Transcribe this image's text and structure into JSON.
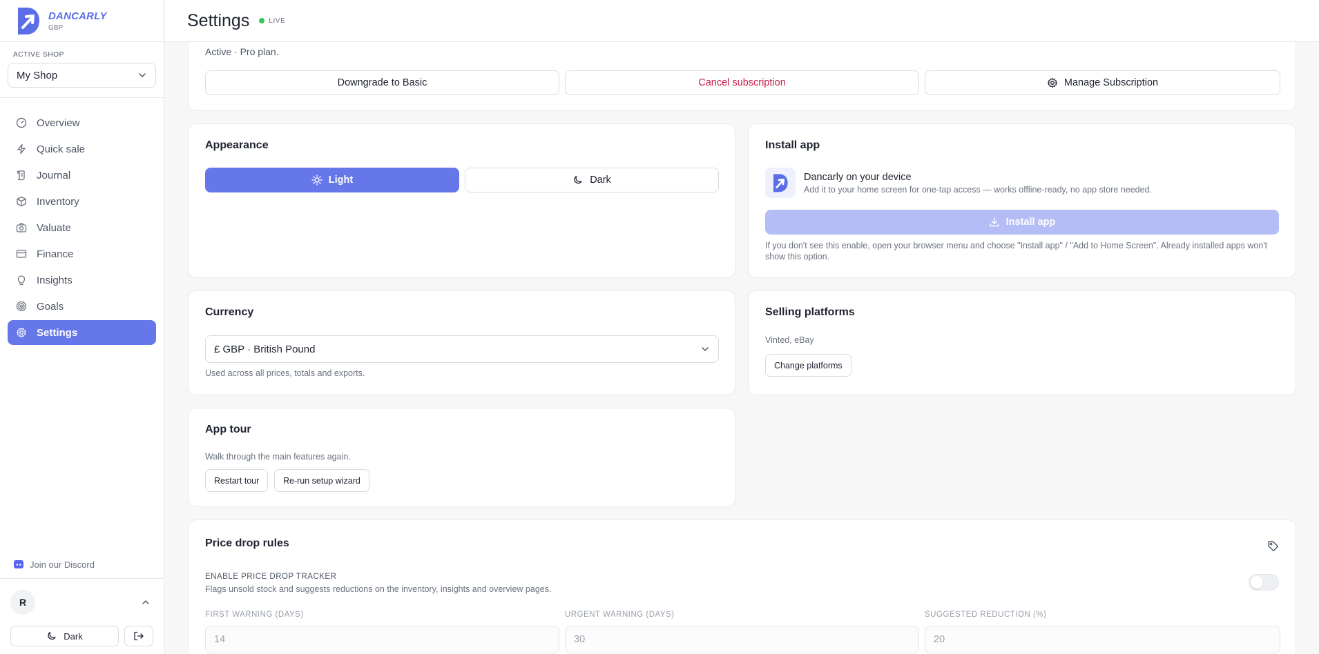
{
  "brand": {
    "name": "DANCARLY",
    "currency": "GBP"
  },
  "shop": {
    "label": "ACTIVE SHOP",
    "value": "My Shop"
  },
  "nav": {
    "overview": "Overview",
    "quick_sale": "Quick sale",
    "journal": "Journal",
    "inventory": "Inventory",
    "valuate": "Valuate",
    "finance": "Finance",
    "insights": "Insights",
    "goals": "Goals",
    "settings": "Settings"
  },
  "discord": "Join our Discord",
  "user": {
    "initial": "R"
  },
  "footer": {
    "theme_label": "Dark"
  },
  "header": {
    "title": "Settings",
    "status": "LIVE"
  },
  "subscription": {
    "status": "Active · Pro plan.",
    "downgrade": "Downgrade to Basic",
    "cancel": "Cancel subscription",
    "manage": "Manage Subscription"
  },
  "appearance": {
    "title": "Appearance",
    "light": "Light",
    "dark": "Dark"
  },
  "install": {
    "title": "Install app",
    "heading": "Dancarly on your device",
    "desc": "Add it to your home screen for one-tap access — works offline-ready, no app store needed.",
    "button": "Install app",
    "note": "If you don't see this enable, open your browser menu and choose \"Install app\" / \"Add to Home Screen\". Already installed apps won't show this option."
  },
  "currency": {
    "title": "Currency",
    "value": "£ GBP · British Pound",
    "note": "Used across all prices, totals and exports."
  },
  "platforms": {
    "title": "Selling platforms",
    "list": "Vinted, eBay",
    "button": "Change platforms"
  },
  "tour": {
    "title": "App tour",
    "desc": "Walk through the main features again.",
    "restart": "Restart tour",
    "rerun": "Re-run setup wizard"
  },
  "price_drop": {
    "title": "Price drop rules",
    "enable_label": "ENABLE PRICE DROP TRACKER",
    "enable_desc": "Flags unsold stock and suggests reductions on the inventory, insights and overview pages.",
    "first_label": "FIRST WARNING (DAYS)",
    "first_value": "14",
    "urgent_label": "URGENT WARNING (DAYS)",
    "urgent_value": "30",
    "reduction_label": "SUGGESTED REDUCTION (%)",
    "reduction_value": "20"
  },
  "colors": {
    "accent": "#6677ea",
    "danger": "#c81e4a",
    "live": "#34c759"
  }
}
